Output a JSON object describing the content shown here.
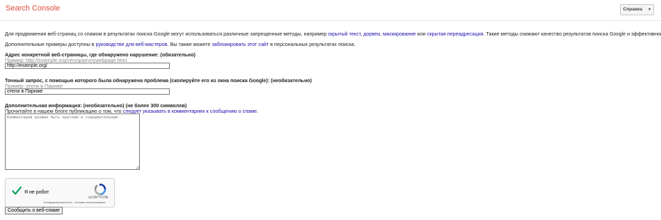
{
  "header": {
    "logo": "Search Console",
    "help_label": "Справка",
    "help_caret": "▾"
  },
  "intro": {
    "p1_before": "Для продвижения веб-страниц со спамом в результатах поиска Google могут использоваться различные запрещенные методы, например ",
    "link_hidden_text": "скрытый текст",
    "sep1": ", ",
    "link_doorways": "дорвеи",
    "sep2": ", ",
    "link_cloaking": "маскирование",
    "or_word": " или ",
    "link_sneaky_redirect": "скрытая переадресация",
    "p1_after": ". Такие методы снижают качество результатов поиска Google и эффективность поиска.",
    "p2_before": "Дополнительные примеры доступны в ",
    "link_guidelines": "руководстве для веб-мастеров",
    "p2_mid": ". Вы также можете ",
    "link_block_site": "заблокировать этот сайт",
    "p2_after": " в персональных результатах поиска."
  },
  "form": {
    "url_label": "Адрес конкретной веб-страницы, где обнаружено нарушение: (обязательно)",
    "url_hint": "Пример: http://example.org/veryspammywebpage.html",
    "url_value": "http://example.org/",
    "query_label": "Точный запрос, с помощью которого была обнаружена проблема (скопируйте его из окна поиска Google): (необязательно)",
    "query_hint": "Пример: отели в Париже",
    "query_value": "отели в Париже",
    "info_label": "Дополнительная информация: (необязательно) (не более 300 символов)",
    "info_text_before": "Прочитайте в нашем блоге публикацию о том, что ",
    "info_link": "следует указывать в комментариях к сообщению о спаме",
    "info_text_after": ".",
    "comment_placeholder": "Комментарий должен быть кратким и содержательным.",
    "submit_label": "Сообщить о веб-спаме"
  },
  "captcha": {
    "label": "Я не робот",
    "brand": "reCAPTCHA",
    "links": "Конфиденциальность - Условия использования"
  },
  "colors": {
    "logo": "#dd4b39",
    "link": "#1a0dab",
    "check": "#009e55"
  }
}
